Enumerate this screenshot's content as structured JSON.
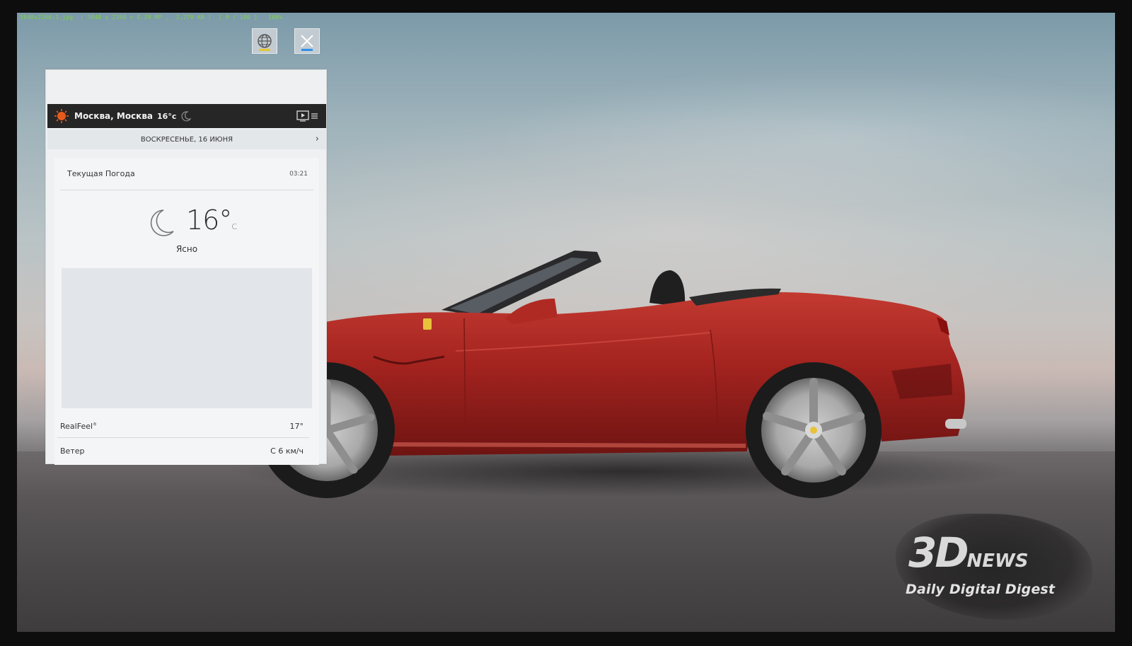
{
  "osd": {
    "info": "3840x2160-1.jpg  ( 3840 x 2160 = 8.29 MP ,  2,279 KB )  [ 9 / 100 ]   100%"
  },
  "top_buttons": {
    "globe_icon": "globe-icon",
    "close_icon": "close-icon",
    "globe_accent": "#e5c531",
    "close_accent": "#2f8fe8"
  },
  "weather": {
    "header": {
      "city": "Москва, Москва",
      "temp": "16°c",
      "sun_icon": "sun-icon",
      "moon_icon": "moon-icon",
      "menu_icon": "tv-menu-icon"
    },
    "date": "ВОСКРЕСЕНЬЕ, 16 ИЮНЯ",
    "current": {
      "title": "Текущая Погода",
      "time": "03:21",
      "temp": "16°",
      "unit": "C",
      "condition": "Ясно"
    },
    "stats": [
      {
        "label": "RealFeel",
        "sup": "®",
        "value": "17°"
      },
      {
        "label": "Ветер",
        "value": "С 6 км/ч"
      }
    ]
  },
  "watermark": {
    "brand": "3D",
    "brand_suffix": "NEWS",
    "tagline": "Daily Digital Digest"
  },
  "colors": {
    "car_red": "#a3231f",
    "header_bg": "#262626",
    "sun_orange": "#e85a1b"
  }
}
